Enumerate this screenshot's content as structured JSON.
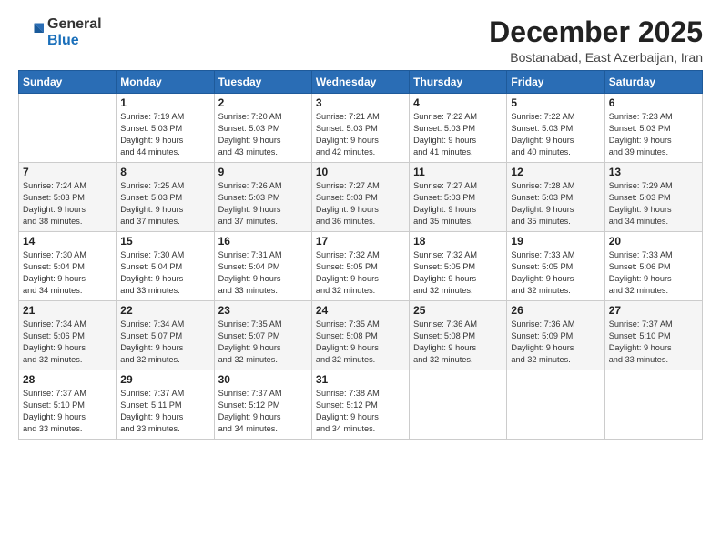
{
  "logo": {
    "general": "General",
    "blue": "Blue"
  },
  "header": {
    "month_year": "December 2025",
    "location": "Bostanabad, East Azerbaijan, Iran"
  },
  "weekdays": [
    "Sunday",
    "Monday",
    "Tuesday",
    "Wednesday",
    "Thursday",
    "Friday",
    "Saturday"
  ],
  "weeks": [
    [
      {
        "day": "",
        "info": ""
      },
      {
        "day": "1",
        "info": "Sunrise: 7:19 AM\nSunset: 5:03 PM\nDaylight: 9 hours\nand 44 minutes."
      },
      {
        "day": "2",
        "info": "Sunrise: 7:20 AM\nSunset: 5:03 PM\nDaylight: 9 hours\nand 43 minutes."
      },
      {
        "day": "3",
        "info": "Sunrise: 7:21 AM\nSunset: 5:03 PM\nDaylight: 9 hours\nand 42 minutes."
      },
      {
        "day": "4",
        "info": "Sunrise: 7:22 AM\nSunset: 5:03 PM\nDaylight: 9 hours\nand 41 minutes."
      },
      {
        "day": "5",
        "info": "Sunrise: 7:22 AM\nSunset: 5:03 PM\nDaylight: 9 hours\nand 40 minutes."
      },
      {
        "day": "6",
        "info": "Sunrise: 7:23 AM\nSunset: 5:03 PM\nDaylight: 9 hours\nand 39 minutes."
      }
    ],
    [
      {
        "day": "7",
        "info": "Sunrise: 7:24 AM\nSunset: 5:03 PM\nDaylight: 9 hours\nand 38 minutes."
      },
      {
        "day": "8",
        "info": "Sunrise: 7:25 AM\nSunset: 5:03 PM\nDaylight: 9 hours\nand 37 minutes."
      },
      {
        "day": "9",
        "info": "Sunrise: 7:26 AM\nSunset: 5:03 PM\nDaylight: 9 hours\nand 37 minutes."
      },
      {
        "day": "10",
        "info": "Sunrise: 7:27 AM\nSunset: 5:03 PM\nDaylight: 9 hours\nand 36 minutes."
      },
      {
        "day": "11",
        "info": "Sunrise: 7:27 AM\nSunset: 5:03 PM\nDaylight: 9 hours\nand 35 minutes."
      },
      {
        "day": "12",
        "info": "Sunrise: 7:28 AM\nSunset: 5:03 PM\nDaylight: 9 hours\nand 35 minutes."
      },
      {
        "day": "13",
        "info": "Sunrise: 7:29 AM\nSunset: 5:03 PM\nDaylight: 9 hours\nand 34 minutes."
      }
    ],
    [
      {
        "day": "14",
        "info": "Sunrise: 7:30 AM\nSunset: 5:04 PM\nDaylight: 9 hours\nand 34 minutes."
      },
      {
        "day": "15",
        "info": "Sunrise: 7:30 AM\nSunset: 5:04 PM\nDaylight: 9 hours\nand 33 minutes."
      },
      {
        "day": "16",
        "info": "Sunrise: 7:31 AM\nSunset: 5:04 PM\nDaylight: 9 hours\nand 33 minutes."
      },
      {
        "day": "17",
        "info": "Sunrise: 7:32 AM\nSunset: 5:05 PM\nDaylight: 9 hours\nand 32 minutes."
      },
      {
        "day": "18",
        "info": "Sunrise: 7:32 AM\nSunset: 5:05 PM\nDaylight: 9 hours\nand 32 minutes."
      },
      {
        "day": "19",
        "info": "Sunrise: 7:33 AM\nSunset: 5:05 PM\nDaylight: 9 hours\nand 32 minutes."
      },
      {
        "day": "20",
        "info": "Sunrise: 7:33 AM\nSunset: 5:06 PM\nDaylight: 9 hours\nand 32 minutes."
      }
    ],
    [
      {
        "day": "21",
        "info": "Sunrise: 7:34 AM\nSunset: 5:06 PM\nDaylight: 9 hours\nand 32 minutes."
      },
      {
        "day": "22",
        "info": "Sunrise: 7:34 AM\nSunset: 5:07 PM\nDaylight: 9 hours\nand 32 minutes."
      },
      {
        "day": "23",
        "info": "Sunrise: 7:35 AM\nSunset: 5:07 PM\nDaylight: 9 hours\nand 32 minutes."
      },
      {
        "day": "24",
        "info": "Sunrise: 7:35 AM\nSunset: 5:08 PM\nDaylight: 9 hours\nand 32 minutes."
      },
      {
        "day": "25",
        "info": "Sunrise: 7:36 AM\nSunset: 5:08 PM\nDaylight: 9 hours\nand 32 minutes."
      },
      {
        "day": "26",
        "info": "Sunrise: 7:36 AM\nSunset: 5:09 PM\nDaylight: 9 hours\nand 32 minutes."
      },
      {
        "day": "27",
        "info": "Sunrise: 7:37 AM\nSunset: 5:10 PM\nDaylight: 9 hours\nand 33 minutes."
      }
    ],
    [
      {
        "day": "28",
        "info": "Sunrise: 7:37 AM\nSunset: 5:10 PM\nDaylight: 9 hours\nand 33 minutes."
      },
      {
        "day": "29",
        "info": "Sunrise: 7:37 AM\nSunset: 5:11 PM\nDaylight: 9 hours\nand 33 minutes."
      },
      {
        "day": "30",
        "info": "Sunrise: 7:37 AM\nSunset: 5:12 PM\nDaylight: 9 hours\nand 34 minutes."
      },
      {
        "day": "31",
        "info": "Sunrise: 7:38 AM\nSunset: 5:12 PM\nDaylight: 9 hours\nand 34 minutes."
      },
      {
        "day": "",
        "info": ""
      },
      {
        "day": "",
        "info": ""
      },
      {
        "day": "",
        "info": ""
      }
    ]
  ]
}
